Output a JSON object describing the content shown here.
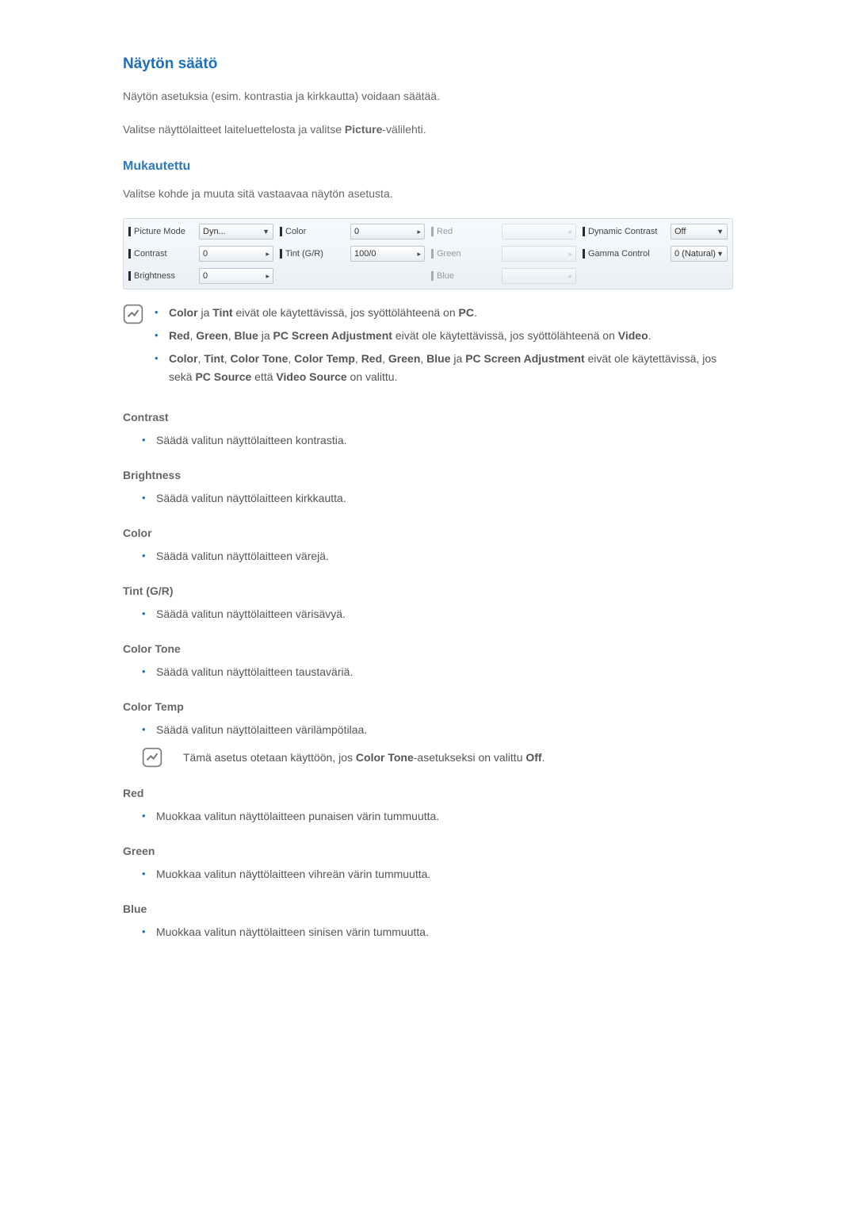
{
  "title": "Näytön säätö",
  "intro1": "Näytön asetuksia (esim. kontrastia ja kirkkautta) voidaan säätää.",
  "intro2_pre": "Valitse näyttölaitteet laiteluettelosta ja valitse ",
  "intro2_bold": "Picture",
  "intro2_post": "-välilehti.",
  "sub1": "Mukautettu",
  "sub1_para": "Valitse kohde ja muuta sitä vastaavaa näytön asetusta.",
  "panel": {
    "picture_mode_label": "Picture Mode",
    "picture_mode_val": "Dyn...",
    "color_label": "Color",
    "color_val": "0",
    "red_label": "Red",
    "red_val": "",
    "dyn_contrast_label": "Dynamic Contrast",
    "dyn_contrast_val": "Off",
    "contrast_label": "Contrast",
    "contrast_val": "0",
    "tint_label": "Tint (G/R)",
    "tint_val": "100/0",
    "green_label": "Green",
    "green_val": "",
    "gamma_label": "Gamma Control",
    "gamma_val": "0 (Natural)",
    "brightness_label": "Brightness",
    "brightness_val": "0",
    "blue_label": "Blue",
    "blue_val": ""
  },
  "note1_parts": {
    "color": "Color",
    "ja1": " ja ",
    "tint": "Tint",
    "rest1": " eivät ole käytettävissä, jos syöttölähteenä on ",
    "pc": "PC",
    "period": "."
  },
  "note2_parts": {
    "red": "Red",
    "c1": ", ",
    "green": "Green",
    "c2": ", ",
    "blue": "Blue",
    "ja": " ja ",
    "pcs": "PC Screen Adjustment",
    "rest": " eivät ole käytettävissä, jos syöttölähteenä on ",
    "video": "Video",
    "period": "."
  },
  "note3_parts": {
    "color": "Color",
    "c1": ", ",
    "tint": "Tint",
    "c2": ", ",
    "ctone": "Color Tone",
    "c3": ", ",
    "ctemp": "Color Temp",
    "c4": ", ",
    "red": "Red",
    "c5": ", ",
    "green": "Green",
    "c6": ", ",
    "blue": "Blue",
    "ja": " ja ",
    "pcs": "PC Screen Adjustment",
    "rest1": " eivät ole käytettävissä, jos sekä ",
    "pcsrc": "PC Source",
    "etta": " että ",
    "vsrc": "Video Source",
    "rest2": " on valittu."
  },
  "props": {
    "contrast_h": "Contrast",
    "contrast_li": "Säädä valitun näyttölaitteen kontrastia.",
    "brightness_h": "Brightness",
    "brightness_li": "Säädä valitun näyttölaitteen kirkkautta.",
    "color_h": "Color",
    "color_li": "Säädä valitun näyttölaitteen värejä.",
    "tint_h": "Tint (G/R)",
    "tint_li": "Säädä valitun näyttölaitteen värisävyä.",
    "ctone_h": "Color Tone",
    "ctone_li": "Säädä valitun näyttölaitteen taustaväriä.",
    "ctemp_h": "Color Temp",
    "ctemp_li": "Säädä valitun näyttölaitteen värilämpötilaa.",
    "ctemp_note_pre": "Tämä asetus otetaan käyttöön, jos ",
    "ctemp_note_b1": "Color Tone",
    "ctemp_note_mid": "-asetukseksi on valittu ",
    "ctemp_note_b2": "Off",
    "ctemp_note_post": ".",
    "red_h": "Red",
    "red_li": "Muokkaa valitun näyttölaitteen punaisen värin tummuutta.",
    "green_h": "Green",
    "green_li": "Muokkaa valitun näyttölaitteen vihreän värin tummuutta.",
    "blue_h": "Blue",
    "blue_li": "Muokkaa valitun näyttölaitteen sinisen värin tummuutta."
  }
}
